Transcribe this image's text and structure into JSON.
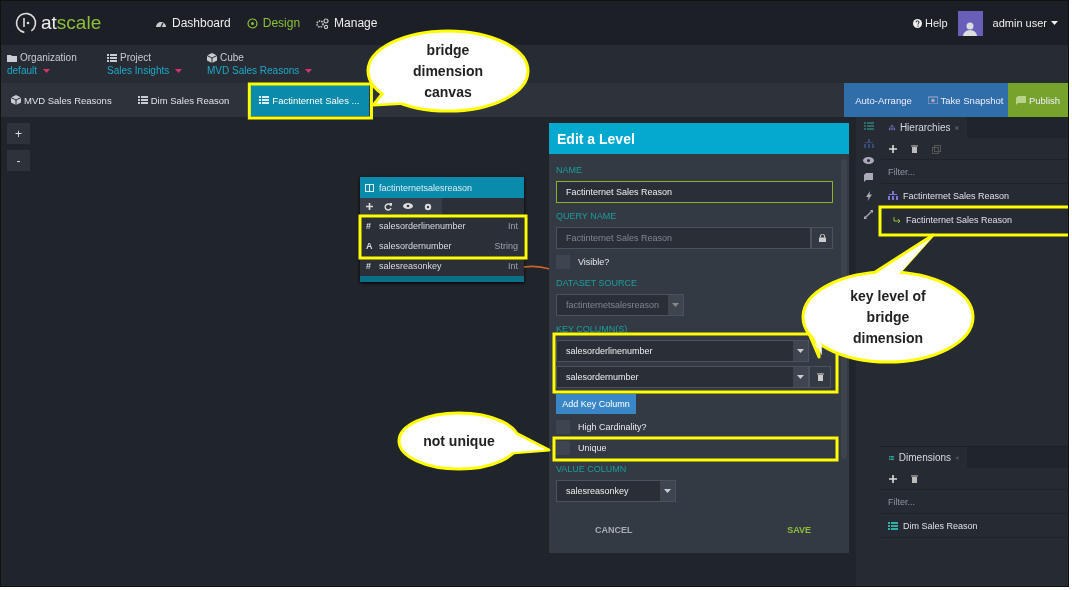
{
  "logo": {
    "part_1": "at",
    "part_2": "scale"
  },
  "nav": [
    {
      "label": "Dashboard",
      "selected": false
    },
    {
      "label": "Design",
      "selected": true
    },
    {
      "label": "Manage",
      "selected": false
    }
  ],
  "help": "Help",
  "user": "admin user",
  "breadcrumbs": [
    {
      "label": "Organization",
      "value": "default"
    },
    {
      "label": "Project",
      "value": "Sales Insights"
    },
    {
      "label": "Cube",
      "value": "MVD Sales Reasons"
    }
  ],
  "tabs": [
    {
      "label": "MVD Sales Reasons",
      "kind": "cube",
      "selected": false
    },
    {
      "label": "Dim Sales Reason",
      "kind": "dimension",
      "selected": false
    },
    {
      "label": "Factinternet Sales ...",
      "kind": "dimension",
      "selected": true
    }
  ],
  "actions": [
    {
      "label": "Auto-Arrange",
      "kind": "arrange"
    },
    {
      "label": "Take Snapshot",
      "kind": "snapshot"
    },
    {
      "label": "Publish",
      "kind": "publish"
    }
  ],
  "zoom_controls": [
    "+",
    "-"
  ],
  "table": {
    "title": "factinternetsalesreason",
    "columns": [
      {
        "symbol": "#",
        "name": "salesorderlinenumber",
        "type": "Int"
      },
      {
        "symbol": "A",
        "name": "salesordernumber",
        "type": "String"
      },
      {
        "symbol": "#",
        "name": "salesreasonkey",
        "type": "Int"
      }
    ]
  },
  "edit_panel": {
    "title": "Edit a Level",
    "fields": [
      {
        "kind": "text",
        "label": "NAME",
        "value": "Factinternet Sales Reason",
        "focused": true
      },
      {
        "kind": "locked",
        "label": "QUERY NAME",
        "value": "Factinternet Sales Reason"
      },
      {
        "kind": "checkbox",
        "label": "Visible?",
        "checked": false
      },
      {
        "kind": "select",
        "label": "DATASET SOURCE",
        "value": "factinternetsalesreason",
        "disabled": true
      },
      {
        "kind": "multi",
        "label": "KEY COLUMN(S)",
        "values": [
          "salesorderlinenumber",
          "salesordernumber"
        ],
        "button": "Add Key Column"
      },
      {
        "kind": "checkbox",
        "label": "High Cardinality?",
        "checked": false
      },
      {
        "kind": "checkbox",
        "label": "Unique",
        "checked": false
      },
      {
        "kind": "select",
        "label": "VALUE COLUMN",
        "value": "salesreasonkey",
        "disabled": false
      }
    ],
    "cancel": "CANCEL",
    "save": "SAVE"
  },
  "hierarchies": {
    "title": "Hierarchies",
    "filter_placeholder": "Filter...",
    "items": [
      {
        "label": "Factinternet Sales Reason",
        "children": [
          {
            "label": "Factinternet Sales Reason"
          }
        ]
      }
    ]
  },
  "dimensions": {
    "title": "Dimensions",
    "filter_placeholder": "Filter...",
    "items": [
      {
        "label": "Dim Sales Reason"
      }
    ]
  },
  "callouts": [
    {
      "text": "bridge dimension canvas"
    },
    {
      "text": "key level of bridge dimension"
    },
    {
      "text": "not unique"
    }
  ]
}
